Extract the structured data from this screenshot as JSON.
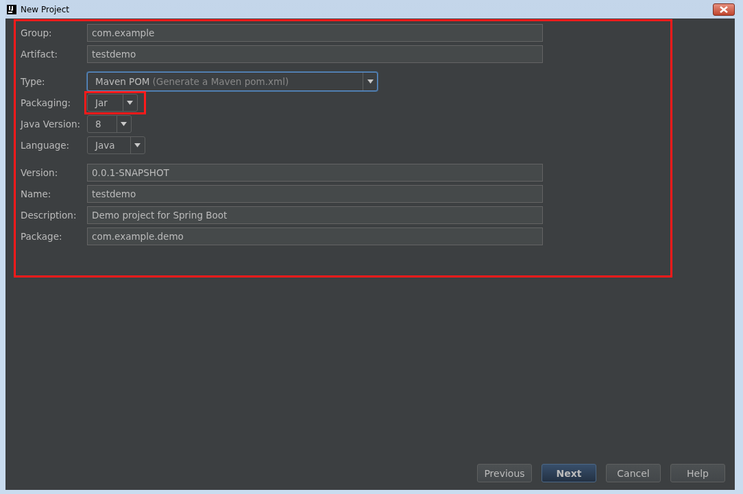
{
  "window": {
    "title": "New Project"
  },
  "fields": [
    {
      "kind": "text",
      "label": "Group:",
      "value": "com.example"
    },
    {
      "kind": "text",
      "label": "Artifact:",
      "value": "testdemo"
    },
    {
      "kind": "gap"
    },
    {
      "kind": "combo",
      "label": "Type:",
      "value": "Maven POM",
      "hint": "(Generate a Maven pom.xml)",
      "focused": true
    },
    {
      "kind": "combo",
      "label": "Packaging:",
      "value": "Jar",
      "focused": false,
      "highlighted": true
    },
    {
      "kind": "combo",
      "label": "Java Version:",
      "value": "8",
      "focused": false
    },
    {
      "kind": "combo",
      "label": "Language:",
      "value": "Java",
      "focused": false
    },
    {
      "kind": "gap"
    },
    {
      "kind": "text",
      "label": "Version:",
      "value": "0.0.1-SNAPSHOT"
    },
    {
      "kind": "text",
      "label": "Name:",
      "value": "testdemo"
    },
    {
      "kind": "text",
      "label": "Description:",
      "value": "Demo project for Spring Boot"
    },
    {
      "kind": "text",
      "label": "Package:",
      "value": "com.example.demo"
    }
  ],
  "buttons": [
    {
      "label": "Previous",
      "default": false
    },
    {
      "label": "Next",
      "default": true
    },
    {
      "label": "Cancel",
      "default": false
    },
    {
      "label": "Help",
      "default": false
    }
  ]
}
